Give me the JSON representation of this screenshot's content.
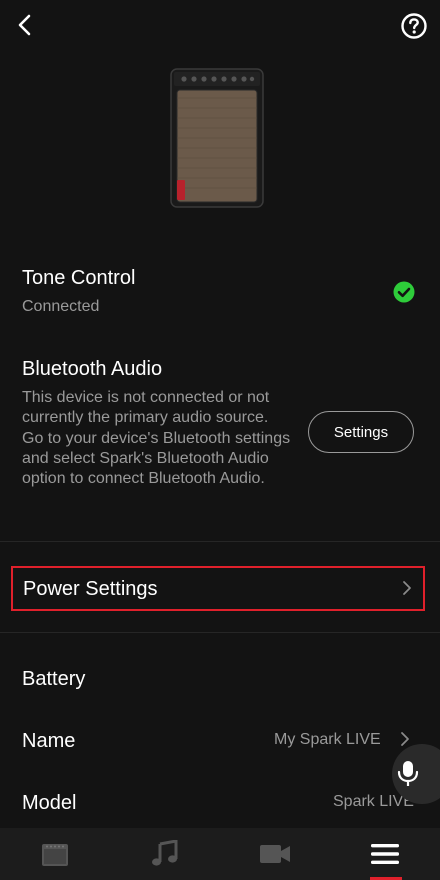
{
  "header": {
    "back_icon": "chevron-left-icon",
    "help_icon": "question-circle-icon"
  },
  "device": {
    "image": "spark-live-amp-image"
  },
  "tone_control": {
    "title": "Tone Control",
    "status": "Connected",
    "status_icon": "check-circle-icon",
    "status_color": "#2ecc3a"
  },
  "bluetooth_audio": {
    "title": "Bluetooth Audio",
    "description": "This device is not connected or not currently the primary audio source. Go to your device's Bluetooth settings and select Spark's Bluetooth Audio option to connect Bluetooth Audio.",
    "settings_button": "Settings"
  },
  "power_settings": {
    "label": "Power Settings",
    "highlight_color": "#e0202b"
  },
  "info_rows": {
    "battery_label": "Battery",
    "name_label": "Name",
    "name_value": "My Spark LIVE",
    "model_label": "Model",
    "model_value": "Spark LIVE"
  },
  "voice": {
    "icon": "microphone-icon"
  },
  "bottom_nav": {
    "items": [
      {
        "icon": "amp-icon"
      },
      {
        "icon": "music-note-icon"
      },
      {
        "icon": "video-camera-icon"
      },
      {
        "icon": "menu-icon",
        "active": true
      }
    ],
    "accent": "#e0202b"
  }
}
